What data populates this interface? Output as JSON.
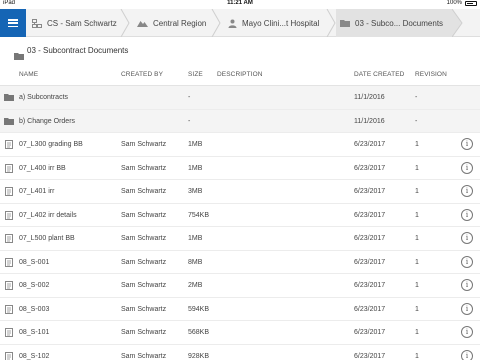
{
  "status_bar": {
    "carrier": "iPad",
    "time": "11:21 AM",
    "battery": "100%"
  },
  "breadcrumb": [
    {
      "label": "CS - Sam Schwartz",
      "icon": "org-icon"
    },
    {
      "label": "Central Region",
      "icon": "region-icon"
    },
    {
      "label": "Mayo Clini...t Hospital",
      "icon": "person-icon"
    },
    {
      "label": "03 - Subco... Documents",
      "icon": "folder-icon"
    }
  ],
  "folder": {
    "title": "03 - Subcontract Documents",
    "icon": "folder-icon"
  },
  "columns": {
    "name": "NAME",
    "created_by": "CREATED BY",
    "size": "SIZE",
    "description": "DESCRIPTION",
    "date_created": "DATE CREATED",
    "revision": "REVISION"
  },
  "rows": [
    {
      "type": "folder",
      "name": "a) Subcontracts",
      "created_by": "",
      "size": "-",
      "description": "",
      "date": "11/1/2016",
      "revision": "-"
    },
    {
      "type": "folder",
      "name": "b) Change Orders",
      "created_by": "",
      "size": "-",
      "description": "",
      "date": "11/1/2016",
      "revision": "-"
    },
    {
      "type": "file",
      "name": "07_L300 grading BB",
      "created_by": "Sam Schwartz",
      "size": "1MB",
      "description": "",
      "date": "6/23/2017",
      "revision": "1"
    },
    {
      "type": "file",
      "name": "07_L400 irr BB",
      "created_by": "Sam Schwartz",
      "size": "1MB",
      "description": "",
      "date": "6/23/2017",
      "revision": "1"
    },
    {
      "type": "file",
      "name": "07_L401 irr",
      "created_by": "Sam Schwartz",
      "size": "3MB",
      "description": "",
      "date": "6/23/2017",
      "revision": "1"
    },
    {
      "type": "file",
      "name": "07_L402 irr details",
      "created_by": "Sam Schwartz",
      "size": "754KB",
      "description": "",
      "date": "6/23/2017",
      "revision": "1"
    },
    {
      "type": "file",
      "name": "07_L500 plant BB",
      "created_by": "Sam Schwartz",
      "size": "1MB",
      "description": "",
      "date": "6/23/2017",
      "revision": "1"
    },
    {
      "type": "file",
      "name": "08_S-001",
      "created_by": "Sam Schwartz",
      "size": "8MB",
      "description": "",
      "date": "6/23/2017",
      "revision": "1"
    },
    {
      "type": "file",
      "name": "08_S-002",
      "created_by": "Sam Schwartz",
      "size": "2MB",
      "description": "",
      "date": "6/23/2017",
      "revision": "1"
    },
    {
      "type": "file",
      "name": "08_S-003",
      "created_by": "Sam Schwartz",
      "size": "594KB",
      "description": "",
      "date": "6/23/2017",
      "revision": "1"
    },
    {
      "type": "file",
      "name": "08_S-101",
      "created_by": "Sam Schwartz",
      "size": "568KB",
      "description": "",
      "date": "6/23/2017",
      "revision": "1"
    },
    {
      "type": "file",
      "name": "08_S-102",
      "created_by": "Sam Schwartz",
      "size": "928KB",
      "description": "",
      "date": "6/23/2017",
      "revision": "1"
    }
  ],
  "info_glyph": "i",
  "colors": {
    "accent": "#1565b5",
    "folder_row": "#f4f4f4",
    "crumb_bar": "#f3f3f3"
  }
}
